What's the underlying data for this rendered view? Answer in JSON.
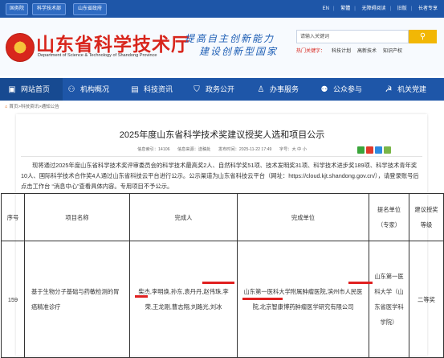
{
  "topbar": {
    "links": [
      "国务院",
      "科学技术部",
      "山东省政府"
    ],
    "right": [
      "EN",
      "繁體",
      "无障碍阅读",
      "旧版",
      "长者专享"
    ]
  },
  "header": {
    "title": "山东省科学技术厅",
    "subtitle": "Department of Science & Technology of Shandong Province",
    "slogan_line1": "提高自主创新能力",
    "slogan_line2": "建设创新型国家",
    "search_placeholder": "请输入关键词",
    "hot_label": "热门关键字：",
    "hot_terms": [
      "科技计划",
      "高新技术",
      "知识产权"
    ]
  },
  "nav": [
    "网站首页",
    "机构概况",
    "科技资讯",
    "政务公开",
    "办事服务",
    "公众参与",
    "机关党建"
  ],
  "breadcrumb": {
    "home": "⌂",
    "path": "首页>科技资讯>通知公告"
  },
  "article": {
    "title": "2025年度山东省科学技术奖建议授奖人选和项目公示",
    "meta_id": "信息索引：14106",
    "meta_source": "信息来源：送稿处",
    "meta_date": "发布时间：2025-11-22 17:49",
    "meta_font": "字号：大 中 小",
    "body": "现将通过2025年度山东省科学技术奖评审委员会的科学技术最高奖2人、自然科学奖51项、技术发明奖31项、科学技术进步奖189项、科学技术青年奖10人、国际科学技术合作奖4人通过山东省科技云平台进行公示。公示渠道为山东省科技云平台（网址：https://cloud.kjt.shandong.gov.cn/），请登录账号后点击工作台 “消息中心”查看具体内容。专用项目不予公示。"
  },
  "table": {
    "headers": {
      "seq": "序号",
      "name": "项目名称",
      "people": "完成人",
      "units": "完成单位",
      "nominator": "提名单位（专家）",
      "level": "建议授奖等级"
    },
    "row": {
      "seq": "159",
      "name": "基于生物分子基础与药敏检测的胃癌精准诊疗",
      "people": "柴杰,李明焕,孙东,袁丹丹,赵伟珠,李荣,王龙刚,曹志翔,刘路光,刘冰",
      "units": "山东第一医科大学附属肿瘤医院,滨州市人民医院,北京智康博药肿瘤医学研究有限公司",
      "nominator": "山东第一医科大学（山东省医学科学院）",
      "level": "二等奖"
    }
  },
  "colors": {
    "brand_blue": "#1e56a8",
    "title_red": "#d8251c",
    "search_yellow": "#f2b705",
    "annotation_red": "#e02020"
  }
}
